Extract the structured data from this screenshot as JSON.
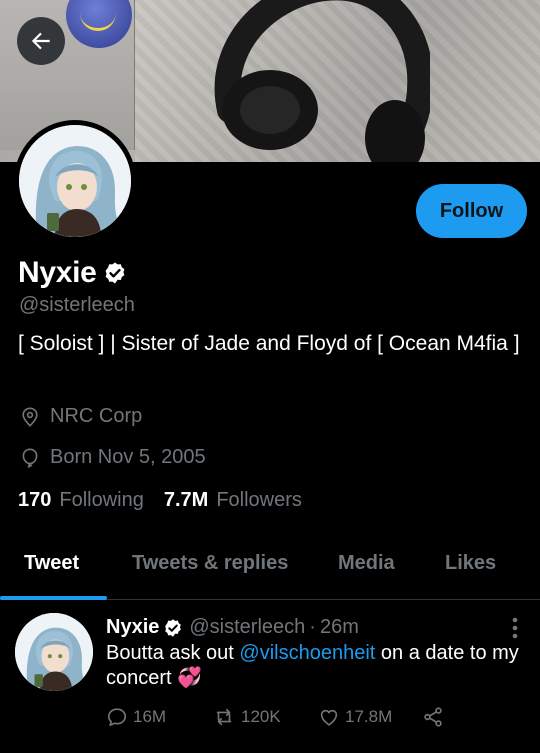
{
  "header": {
    "back_icon": "arrow-left-icon"
  },
  "profile": {
    "name": "Nyxie",
    "verified_icon": "verified-badge-icon",
    "handle": "@sisterleech",
    "bio": "[ Soloist ] | Sister of Jade and Floyd of [ Ocean M4fia ]",
    "location_icon": "location-pin-icon",
    "location": "NRC Corp",
    "birthday_icon": "balloon-icon",
    "birthday": "Born Nov 5, 2005",
    "following_count": "170",
    "following_label": "Following",
    "followers_count": "7.7M",
    "followers_label": "Followers",
    "follow_button": "Follow"
  },
  "tabs": [
    {
      "label": "Tweet",
      "active": true
    },
    {
      "label": "Tweets & replies",
      "active": false
    },
    {
      "label": "Media",
      "active": false
    },
    {
      "label": "Likes",
      "active": false
    }
  ],
  "tweet": {
    "author_name": "Nyxie",
    "author_handle": "@sisterleech",
    "separator": "·",
    "time": "26m",
    "text_before": "Boutta ask out ",
    "mention": "@vilschoenheit",
    "text_after": " on a date to my concert ",
    "emoji": "💞",
    "replies": "16M",
    "retweets": "120K",
    "likes": "17.8M"
  },
  "colors": {
    "accent": "#1d9bf0",
    "background": "#000000",
    "secondary_text": "#71767b",
    "hearts_emoji": "#e0259a"
  }
}
